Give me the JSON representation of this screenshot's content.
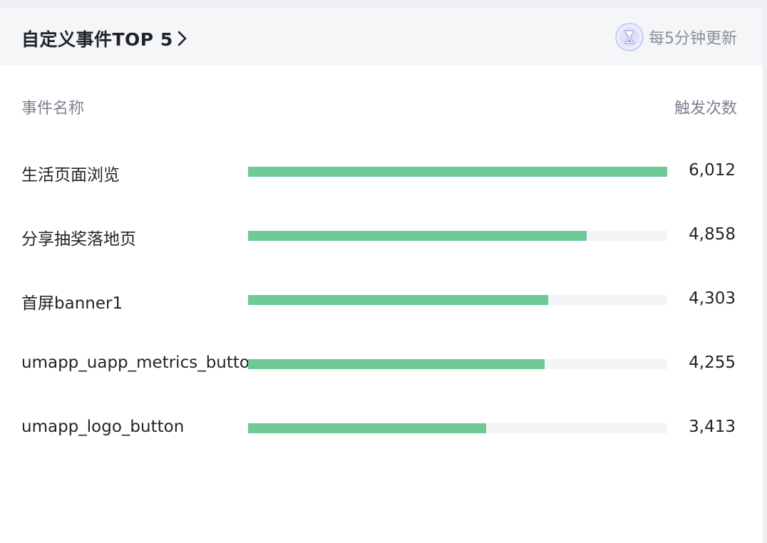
{
  "header": {
    "title": "自定义事件TOP 5",
    "update_text": "每5分钟更新"
  },
  "columns": {
    "name": "事件名称",
    "count": "触发次数"
  },
  "colors": {
    "bar": "#6dca97",
    "track": "#f3f4f6"
  },
  "events": [
    {
      "name": "生活页面浏览",
      "count": "6,012",
      "fraction": 1.0
    },
    {
      "name": "分享抽奖落地页",
      "count": "4,858",
      "fraction": 0.808
    },
    {
      "name": "首屏banner1",
      "count": "4,303",
      "fraction": 0.716
    },
    {
      "name": "umapp_uapp_metrics_button",
      "count": "4,255",
      "fraction": 0.708
    },
    {
      "name": "umapp_logo_button",
      "count": "3,413",
      "fraction": 0.568
    }
  ]
}
